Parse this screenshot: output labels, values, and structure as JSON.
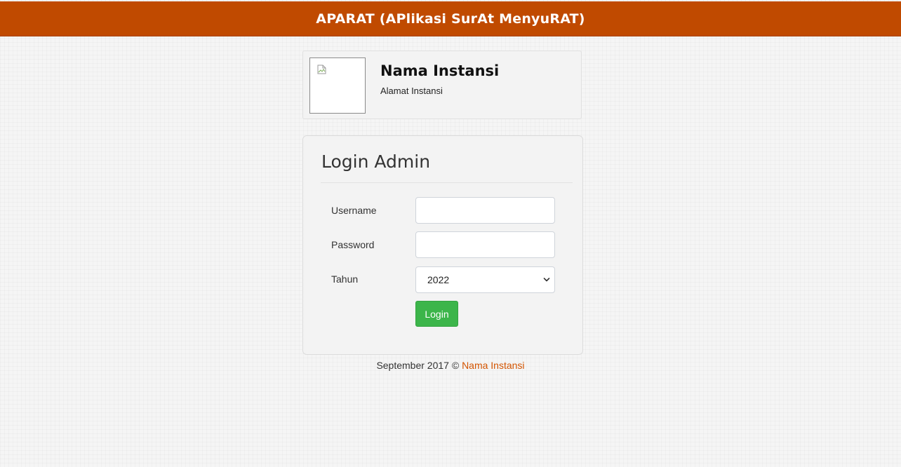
{
  "header": {
    "title": "APARAT (APlikasi SurAt MenyuRAT)",
    "color": "#c04a00"
  },
  "org_card": {
    "logo_icon": "broken-image-icon",
    "name": "Nama Instansi",
    "address": "Alamat Instansi"
  },
  "login": {
    "title": "Login Admin",
    "username_label": "Username",
    "username_value": "",
    "password_label": "Password",
    "password_value": "",
    "year_label": "Tahun",
    "year_selected": "2022",
    "submit_label": "Login",
    "submit_color": "#3cb54a"
  },
  "footer": {
    "text": "September 2017 ©",
    "link_text": "Nama Instansi",
    "link_color": "#d35400"
  }
}
